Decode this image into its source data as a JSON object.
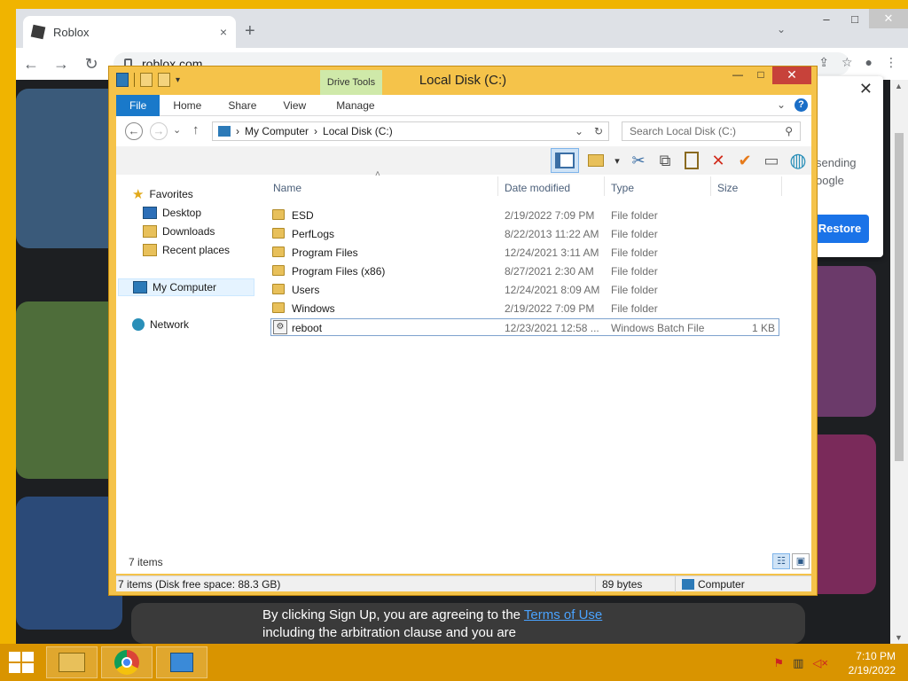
{
  "browser": {
    "tab_title": "Roblox",
    "tab_close": "×",
    "new_tab": "+",
    "tab_search": "⌄",
    "url": "roblox.com",
    "win_min": "–",
    "win_max": "□",
    "win_close": "✕",
    "nav_back": "←",
    "nav_forward": "→",
    "nav_reload": "↻",
    "tb_share": "⇪",
    "tb_star": "☆",
    "tb_profile": "●",
    "tb_menu": "⋮",
    "page": {
      "signup_prefix": "By clicking Sign Up, you are agreeing to the",
      "terms_link": "Terms of Use",
      "signup_suffix": "including the arbitration clause and you are"
    },
    "notice": {
      "close": "✕",
      "line1": "sending",
      "line2": "oogle",
      "restore_label": "Restore"
    }
  },
  "explorer": {
    "title": "Local Disk (C:)",
    "contextual_tab": "Drive Tools",
    "ctrl_min": "—",
    "ctrl_max": "□",
    "ctrl_close": "✕",
    "ribbon_tabs": [
      "File",
      "Home",
      "Share",
      "View",
      "Manage"
    ],
    "ribbon_expand": "⌄",
    "help": "?",
    "nav": {
      "back": "←",
      "forward": "→",
      "recent": "⌄",
      "up": "↑",
      "refresh": "↻"
    },
    "address": {
      "crumbs": [
        "My Computer",
        "Local Disk (C:)"
      ],
      "separator": "›",
      "dropdown": "⌄"
    },
    "search_placeholder": "Search Local Disk (C:)",
    "search_icon": "⚲",
    "toolbar_icons": [
      "preview-pane-icon",
      "new-folder-icon",
      "cut-icon",
      "copy-icon",
      "paste-icon",
      "delete-icon",
      "properties-check-icon",
      "rename-icon",
      "web-icon"
    ],
    "toolbar_glyphs": {
      "cut": "✂",
      "copy": "⧉",
      "paste": "📋",
      "delete": "✕",
      "check": "✔",
      "rename": "▭",
      "globe": "◍",
      "newfolder_menu": "▾"
    },
    "navpane": {
      "favorites": "Favorites",
      "desktop": "Desktop",
      "downloads": "Downloads",
      "recent_places": "Recent places",
      "my_computer": "My Computer",
      "network": "Network"
    },
    "columns": {
      "name": "Name",
      "date_modified": "Date modified",
      "type": "Type",
      "size": "Size",
      "sort_indicator": "˄"
    },
    "files": [
      {
        "name": "ESD",
        "date": "2/19/2022 7:09 PM",
        "type": "File folder",
        "size": "",
        "kind": "folder"
      },
      {
        "name": "PerfLogs",
        "date": "8/22/2013 11:22 AM",
        "type": "File folder",
        "size": "",
        "kind": "folder"
      },
      {
        "name": "Program Files",
        "date": "12/24/2021 3:11 AM",
        "type": "File folder",
        "size": "",
        "kind": "folder"
      },
      {
        "name": "Program Files (x86)",
        "date": "8/27/2021 2:30 AM",
        "type": "File folder",
        "size": "",
        "kind": "folder"
      },
      {
        "name": "Users",
        "date": "12/24/2021 8:09 AM",
        "type": "File folder",
        "size": "",
        "kind": "folder"
      },
      {
        "name": "Windows",
        "date": "2/19/2022 7:09 PM",
        "type": "File folder",
        "size": "",
        "kind": "folder"
      },
      {
        "name": "reboot",
        "date": "12/23/2021 12:58 ...",
        "type": "Windows Batch File",
        "size": "1 KB",
        "kind": "batch"
      }
    ],
    "item_count": "7 items",
    "status": {
      "left": "7 items (Disk free space: 88.3 GB)",
      "middle": "89 bytes",
      "right": "Computer"
    },
    "view_details": "☷",
    "view_large": "▣"
  },
  "taskbar": {
    "time": "7:10 PM",
    "date": "2/19/2022",
    "tray_icons": [
      "flag-icon",
      "network-icon",
      "volume-muted-icon"
    ],
    "tray_glyphs": {
      "flag": "⚑",
      "network": "▥",
      "volume": "🔇"
    }
  },
  "colors": {
    "desktop": "#f0b400",
    "explorer_frame": "#f5c34a",
    "file_tab": "#1979ca",
    "taskbar": "#d99400"
  }
}
